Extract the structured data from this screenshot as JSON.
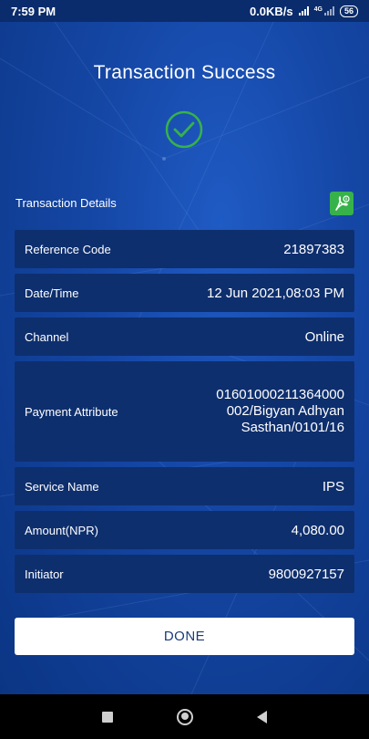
{
  "status_bar": {
    "time": "7:59 PM",
    "speed": "0.0KB/s",
    "network": "4G",
    "battery": "56"
  },
  "title": "Transaction Success",
  "icons": {
    "success": "check-circle-icon",
    "pdf": "pdf-download-icon",
    "accent": "#37b24a"
  },
  "section_label": "Transaction Details",
  "rows": [
    {
      "label": "Reference Code",
      "value": "21897383"
    },
    {
      "label": "Date/Time",
      "value": "12 Jun 2021,08:03 PM"
    },
    {
      "label": "Channel",
      "value": "Online"
    },
    {
      "label": "Payment Attribute",
      "value": "01601000211364000 002/Bigyan Adhyan Sasthan/0101/16"
    },
    {
      "label": "Service Name",
      "value": "IPS"
    },
    {
      "label": "Amount(NPR)",
      "value": "4,080.00"
    },
    {
      "label": "Initiator",
      "value": "9800927157"
    }
  ],
  "done_label": "DONE"
}
